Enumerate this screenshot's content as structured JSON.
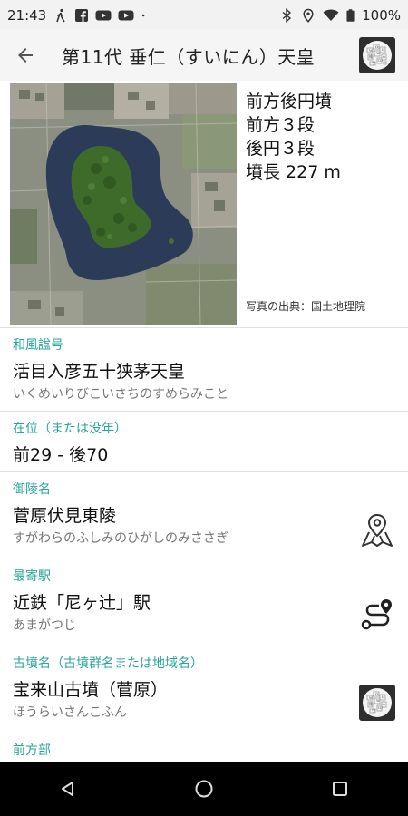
{
  "status_bar": {
    "time": "21:43",
    "battery": "100%",
    "left_icons": [
      "walking-icon",
      "facebook-icon",
      "youtube-icon",
      "youtube-icon",
      "dot-icon"
    ],
    "right_icons": [
      "bluetooth-icon",
      "location-icon",
      "wifi-icon",
      "battery-icon"
    ]
  },
  "app_bar": {
    "title": "第11代 垂仁（すいにん）天皇"
  },
  "hero": {
    "tumulus_lines": [
      "前方後円墳",
      "前方３段",
      "後円３段",
      "墳長 227 m"
    ],
    "photo_credit": "写真の出典：国土地理院"
  },
  "sections": [
    {
      "label": "和風諡号",
      "main": "活目入彦五十狭茅天皇",
      "sub": "いくめいりびこいさちのすめらみこと"
    },
    {
      "label": "在位（または没年）",
      "main": "前29 - 後70",
      "sub": ""
    },
    {
      "label": "御陵名",
      "main": "菅原伏見東陵",
      "sub": "すがわらのふしみのひがしのみささぎ",
      "icon": "map-pin-icon"
    },
    {
      "label": "最寄駅",
      "main": "近鉄「尼ヶ辻」駅",
      "sub": "あまがつじ",
      "icon": "route-icon"
    },
    {
      "label": "古墳名（古墳群名または地域名）",
      "main": "宝来山古墳（菅原）",
      "sub": "ほうらいさんこふん",
      "icon": "wikipedia-icon"
    },
    {
      "label": "前方部",
      "main": "",
      "sub": ""
    }
  ],
  "colors": {
    "accent": "#26a69a",
    "status_bar_bg": "#f2f2f2",
    "app_bar_bg": "#f5f5f5",
    "nav_bar_bg": "#000000",
    "moat_water": "#2b3b58",
    "mound_forest": "#3f6b2a"
  }
}
